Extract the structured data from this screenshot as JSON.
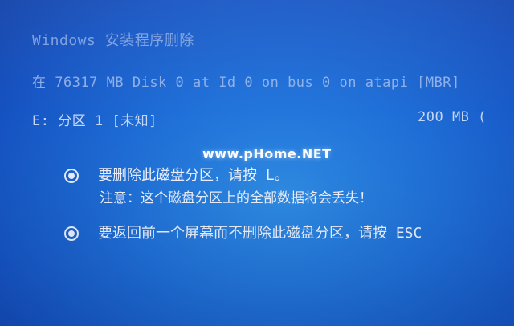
{
  "header": {
    "title": "Windows 安装程序删除"
  },
  "disk": {
    "info": "在 76317 MB Disk 0 at Id 0 on bus 0 on atapi [MBR]"
  },
  "partition": {
    "label": "E:  分区 1 [未知]",
    "size": "200 MB ("
  },
  "watermark": {
    "text": "www.pHome.NET"
  },
  "options": [
    {
      "text": "要删除此磁盘分区，请按 L。",
      "note": "注意：这个磁盘分区上的全部数据将会丢失！"
    },
    {
      "text": "要返回前一个屏幕而不删除此磁盘分区，请按 ESC"
    }
  ],
  "colors": {
    "background": "#1f6fd8",
    "text": "#eef3ff"
  }
}
